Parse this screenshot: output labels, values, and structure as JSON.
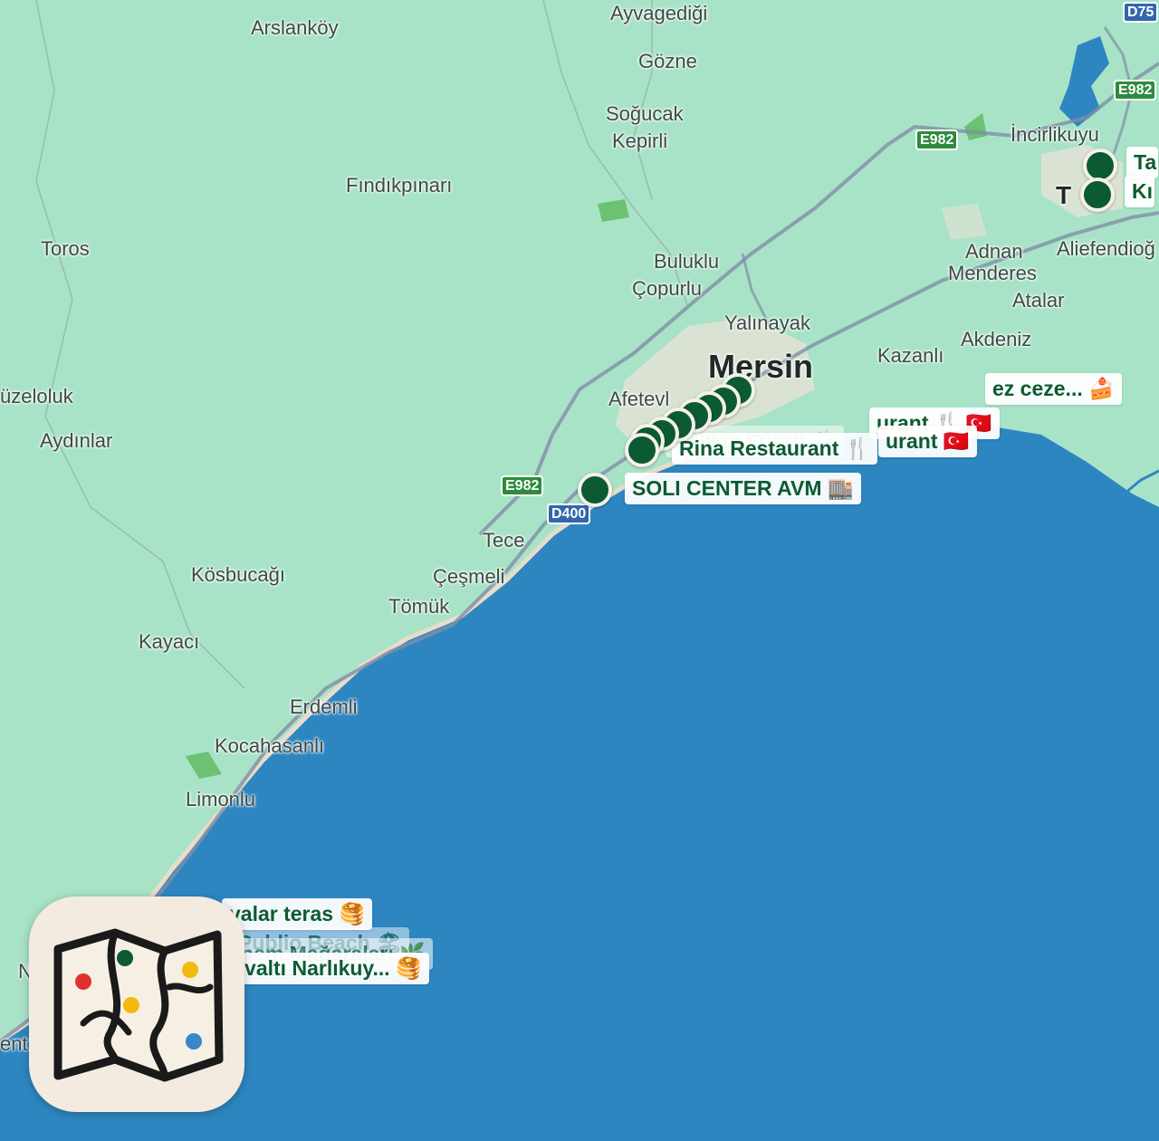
{
  "map": {
    "places": [
      {
        "name": "Arslanköy"
      },
      {
        "name": "Ayvagediği"
      },
      {
        "name": "Gözne"
      },
      {
        "name": "Soğucak"
      },
      {
        "name": "Kepirli"
      },
      {
        "name": "Fındıkpınarı"
      },
      {
        "name": "Toros"
      },
      {
        "name": "Buluklu"
      },
      {
        "name": "Çopurlu"
      },
      {
        "name": "Yalınayak"
      },
      {
        "name": "Mersin"
      },
      {
        "name": "Afetevl"
      },
      {
        "name": "İncirlikuyu"
      },
      {
        "name": "Adnan"
      },
      {
        "name": "Menderes"
      },
      {
        "name": "Aliefendioğ"
      },
      {
        "name": "Atalar"
      },
      {
        "name": "Akdeniz"
      },
      {
        "name": "Kazanlı"
      },
      {
        "name": "üzeloluk"
      },
      {
        "name": "Aydınlar"
      },
      {
        "name": "Tece"
      },
      {
        "name": "Çeşmeli"
      },
      {
        "name": "Tömük"
      },
      {
        "name": "Kösbucağı"
      },
      {
        "name": "Kayacı"
      },
      {
        "name": "Erdemli"
      },
      {
        "name": "Kocahasanlı"
      },
      {
        "name": "Limonlu"
      },
      {
        "name": "N"
      },
      {
        "name": "ent"
      },
      {
        "name": "T"
      },
      {
        "name": "Ta"
      },
      {
        "name": "Kı"
      }
    ],
    "road_shields": [
      {
        "label": "E982",
        "color": "green"
      },
      {
        "label": "E982",
        "color": "green"
      },
      {
        "label": "E982",
        "color": "green"
      },
      {
        "label": "D400",
        "color": "blue"
      },
      {
        "label": "D75",
        "color": "blue"
      }
    ],
    "poi_labels": [
      {
        "text": "SOLI CENTER AVM 🏬"
      },
      {
        "text": "Rina Restaurant 🍴"
      },
      {
        "text": "urant 🇹🇷"
      },
      {
        "text": "urant 🍴 🇹🇷"
      },
      {
        "text": "ez ceze... 🍰"
      },
      {
        "text": "Balıkçı Şükrü 🍴"
      },
      {
        "text": "valar teras 🥞"
      },
      {
        "text": "Publio Beach 🏖"
      },
      {
        "text": "nem Mağaraları 🌿"
      },
      {
        "text": "hvaltı Narlıkuy... 🥞"
      }
    ],
    "colors": {
      "land": "#a9e3c7",
      "sea": "#2e86c1",
      "pin": "#0b5a33",
      "label_text": "#0d5b31"
    }
  },
  "app_icon": {
    "name": "map-app-icon"
  }
}
